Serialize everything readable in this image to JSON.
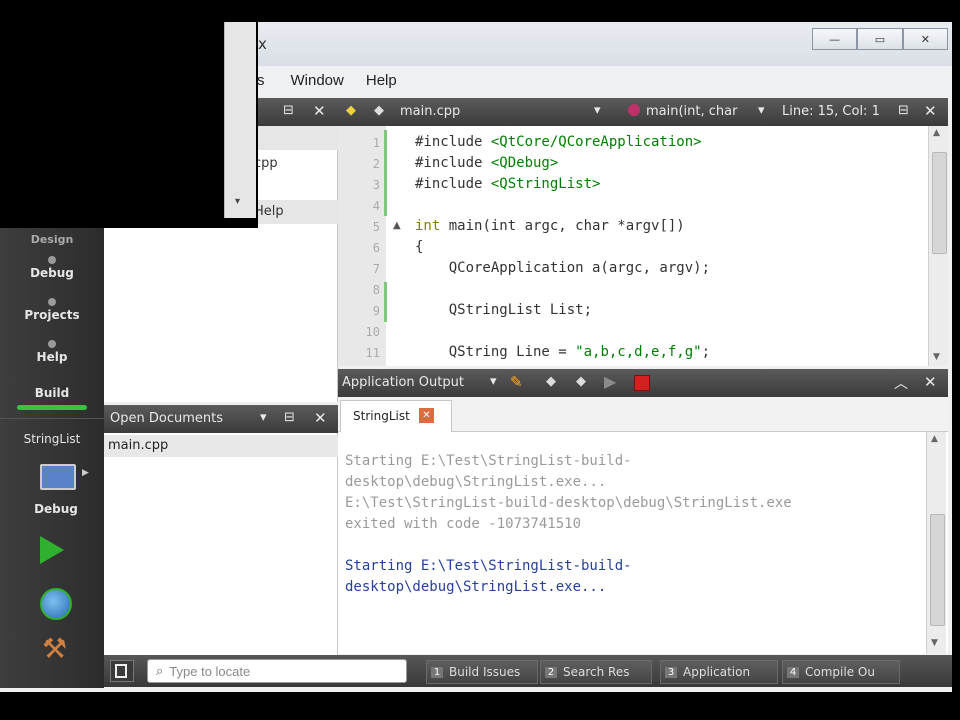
{
  "menu": {
    "items": [
      "s",
      "Window",
      "Help"
    ]
  },
  "titlebar": {
    "fragment": "x",
    "buttons": [
      "—",
      "▭",
      "✕"
    ]
  },
  "overlay_dropdown": {
    "arrow": "▾"
  },
  "editor_toolbar": {
    "file_name": "main.cpp",
    "symbol": "main(int, char",
    "position": "Line: 15, Col: 1"
  },
  "navigation": {
    "items": [
      "cpp",
      "Help"
    ]
  },
  "code": {
    "line_numbers": [
      "1",
      "2",
      "3",
      "4",
      "5",
      "6",
      "7",
      "8",
      "9",
      "10",
      "11"
    ],
    "lines": [
      {
        "plain": "#include ",
        "hl": "<QtCore/QCoreApplication>",
        "rest": ""
      },
      {
        "plain": "#include ",
        "hl": "<QDebug>",
        "rest": ""
      },
      {
        "plain": "#include ",
        "hl": "<QStringList>",
        "rest": ""
      },
      {
        "plain": "",
        "hl": "",
        "rest": ""
      },
      {
        "plain": "",
        "hl": "int",
        "rest": " main(int argc, char *argv[])"
      },
      {
        "plain": "{",
        "hl": "",
        "rest": ""
      },
      {
        "plain": "    QCoreApplication a(argc, argv);",
        "hl": "",
        "rest": ""
      },
      {
        "plain": "",
        "hl": "",
        "rest": ""
      },
      {
        "plain": "    QStringList List;",
        "hl": "",
        "rest": ""
      },
      {
        "plain": "",
        "hl": "",
        "rest": ""
      },
      {
        "plain": "    QString Line = ",
        "hl": "\"a,b,c,d,e,f,g\"",
        "rest": ";"
      }
    ]
  },
  "open_documents": {
    "title": "Open Documents",
    "items": [
      "main.cpp"
    ]
  },
  "output": {
    "title": "Application Output",
    "tab": "StringList",
    "lines_old": [
      "Starting E:\\Test\\StringList-build-",
      "desktop\\debug\\StringList.exe...",
      "E:\\Test\\StringList-build-desktop\\debug\\StringList.exe",
      "exited with code -1073741510"
    ],
    "lines_new": [
      "Starting E:\\Test\\StringList-build-",
      "desktop\\debug\\StringList.exe..."
    ]
  },
  "sidebar": {
    "modes": [
      "Design",
      "Debug",
      "Projects",
      "Help"
    ],
    "build_label": "Build",
    "project": "StringList",
    "target": "Debug"
  },
  "statusbar": {
    "locate_placeholder": "Type to locate",
    "buttons": [
      {
        "num": "1",
        "label": "Build Issues"
      },
      {
        "num": "2",
        "label": "Search Res"
      },
      {
        "num": "3",
        "label": "Application"
      },
      {
        "num": "4",
        "label": "Compile Ou"
      }
    ]
  },
  "colors": {
    "run_green": "#2fb02f",
    "stop_red": "#d32020",
    "active_green": "#3fbf3f"
  }
}
